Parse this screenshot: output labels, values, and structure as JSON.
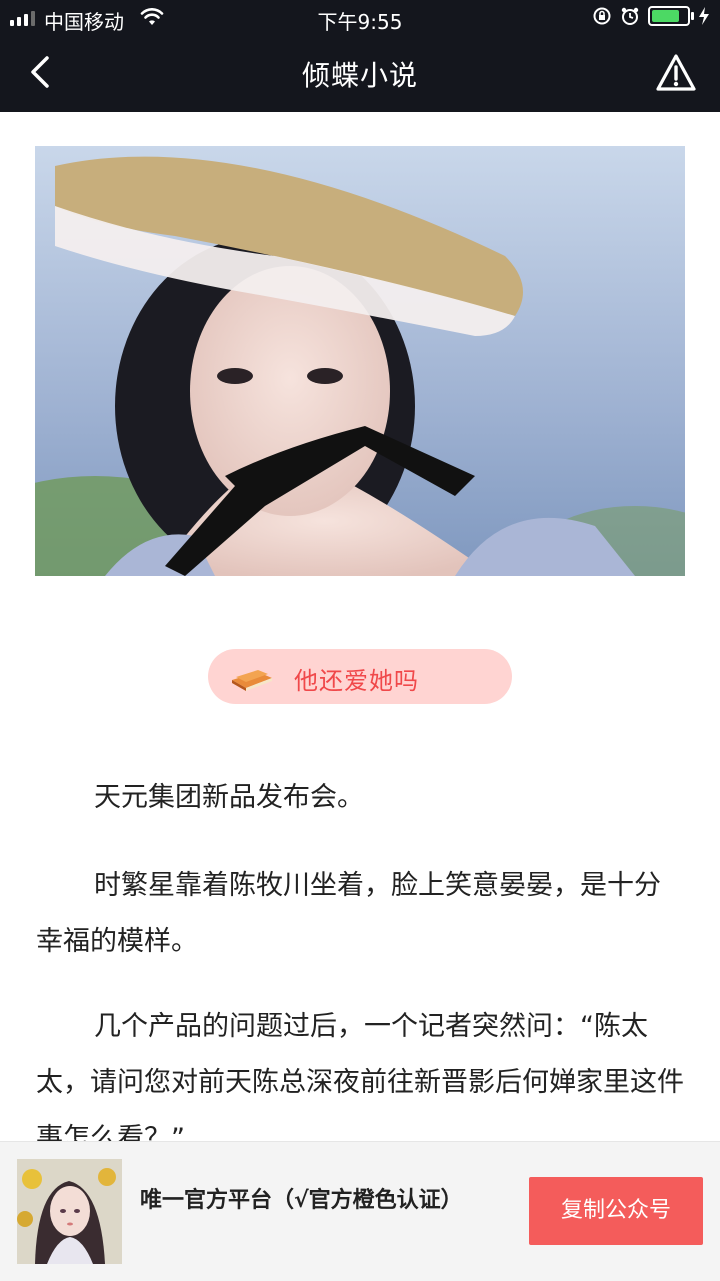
{
  "status_bar": {
    "carrier": "中国移动",
    "time": "下午9:55",
    "battery_level": 0.9
  },
  "navbar": {
    "title": "倾蝶小说"
  },
  "chapter": {
    "title": "他还爱她吗"
  },
  "paragraphs": [
    "天元集团新品发布会。",
    "时繁星靠着陈牧川坐着，脸上笑意晏晏，是十分幸福的模样。",
    "几个产品的问题过后，一个记者突然问：“陈太太，请问您对前天陈总深夜前往新晋影后何婵家里这件事怎么看？”"
  ],
  "bottom_bar": {
    "description": "唯一官方平台（√官方橙色认证）",
    "copy_button": "复制公众号"
  },
  "colors": {
    "bar_bg": "#14161d",
    "accent_red": "#f45c5b",
    "pill_bg": "#ffd4d2",
    "pill_text": "#f0484a"
  }
}
